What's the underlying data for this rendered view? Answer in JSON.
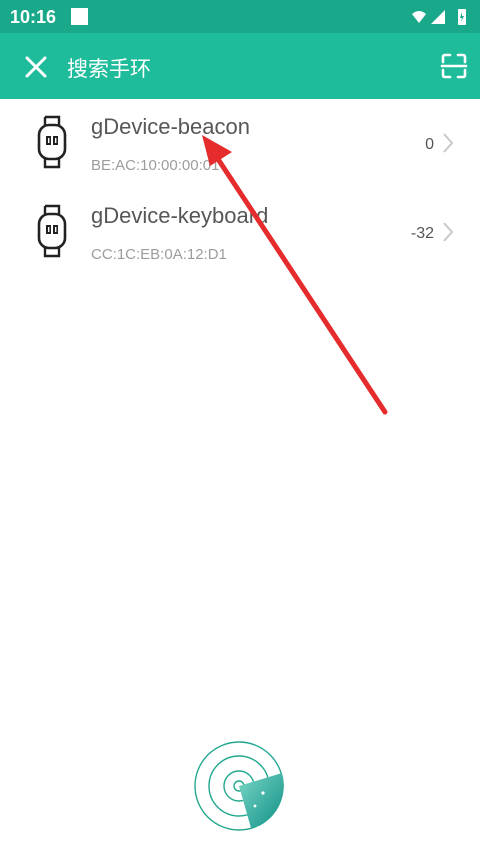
{
  "status_bar": {
    "time": "10:16",
    "icons": [
      "wifi-icon",
      "signal-icon",
      "battery-charging-icon"
    ]
  },
  "app_bar": {
    "title": "搜索手环",
    "close_icon": "close-icon",
    "scan_icon": "scan-icon",
    "background_color": "#1fbc9b"
  },
  "devices": [
    {
      "name": "gDevice-beacon",
      "mac": "BE:AC:10:00:00:01",
      "rssi": "0"
    },
    {
      "name": "gDevice-keyboard",
      "mac": "CC:1C:EB:0A:12:D1",
      "rssi": "-32"
    }
  ],
  "annotation": {
    "color": "#e52b2b"
  },
  "radar": {
    "icon": "radar-scan-icon",
    "accent": "#1aa98f"
  }
}
